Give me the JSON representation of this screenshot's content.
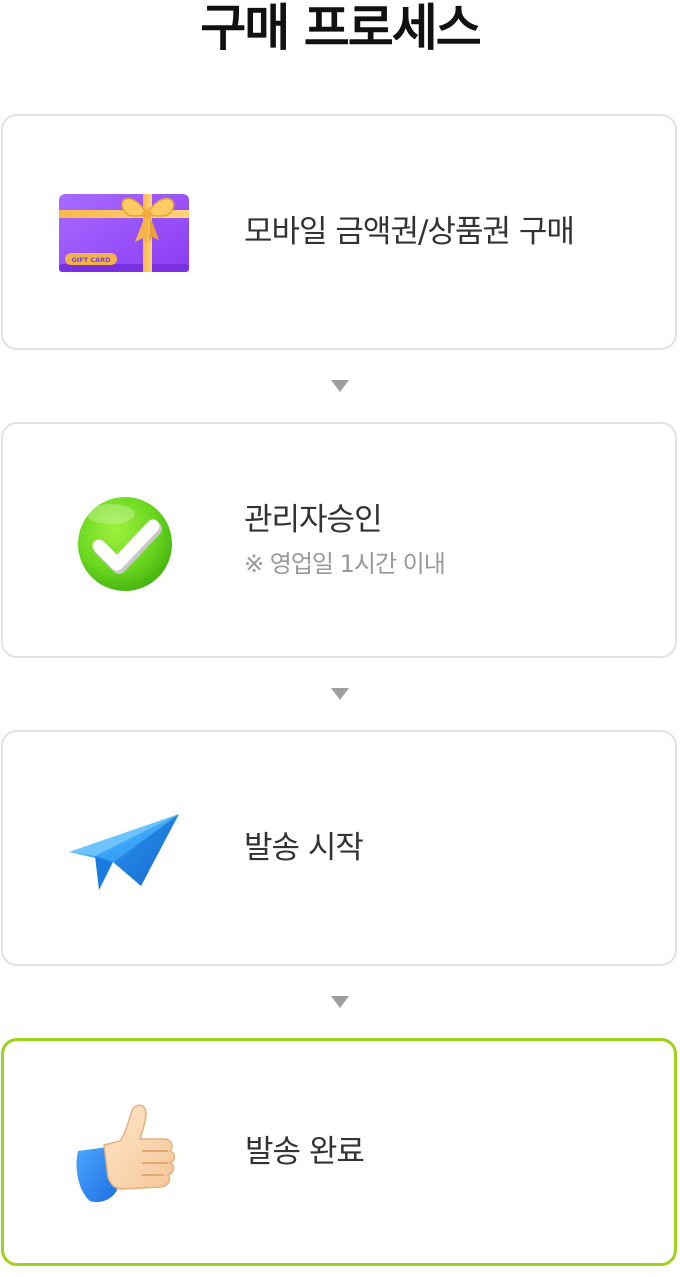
{
  "title": "구매 프로세스",
  "steps": [
    {
      "label": "모바일 금액권/상품권 구매",
      "note": "",
      "icon": "gift-card-icon",
      "gift_card_text": "GIFT CARD"
    },
    {
      "label": "관리자승인",
      "note": "※ 영업일 1시간 이내",
      "icon": "check-circle-icon"
    },
    {
      "label": "발송 시작",
      "note": "",
      "icon": "paper-plane-icon"
    },
    {
      "label": "발송 완료",
      "note": "",
      "icon": "thumbs-up-icon"
    }
  ],
  "colors": {
    "card_border": "#e2e2e2",
    "active_border": "#9fd21a",
    "arrow": "#9e9e9e",
    "title": "#111111",
    "label": "#333333",
    "note": "#999999"
  }
}
